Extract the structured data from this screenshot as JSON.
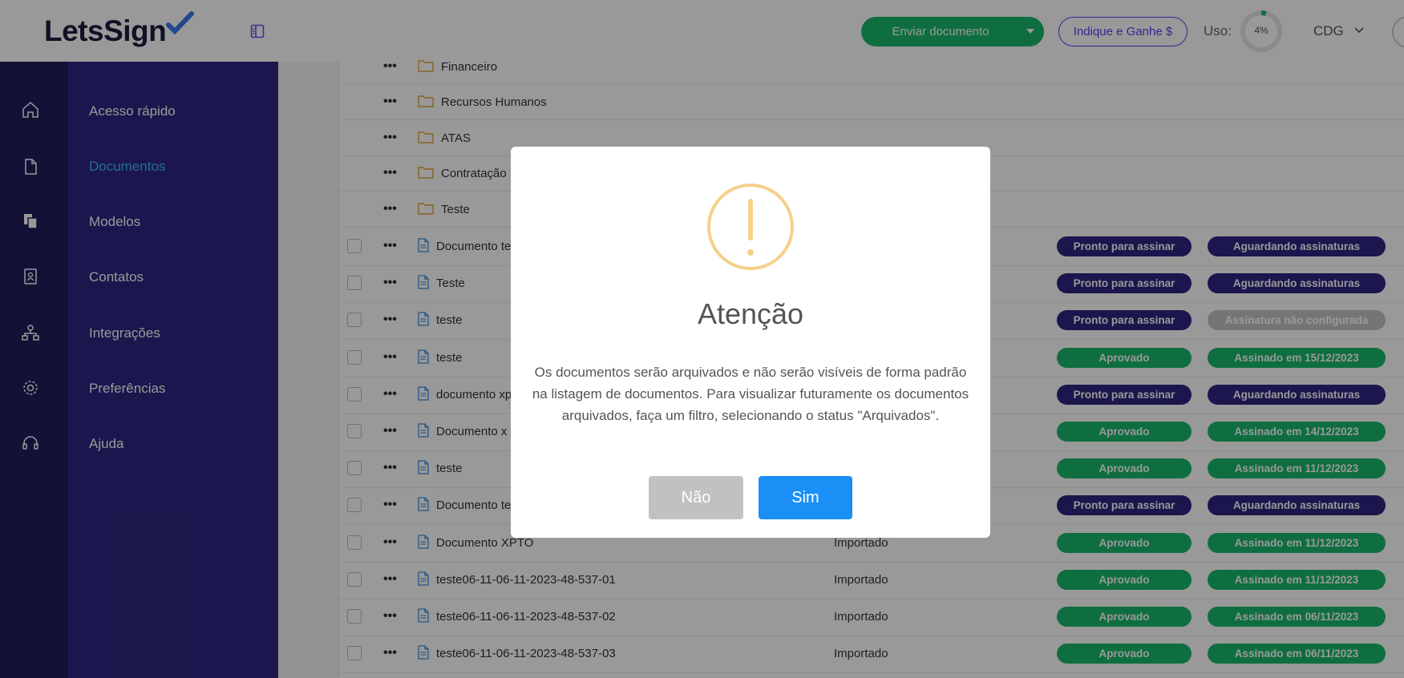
{
  "app": {
    "logo_text": "LetsSign"
  },
  "header": {
    "send_button": "Enviar documento",
    "refer_button": "Indique e Ganhe $",
    "usage_label": "Uso:",
    "usage_value": "4%",
    "usage_percent": 4,
    "account": "CDG"
  },
  "sidebar": {
    "items": [
      {
        "label": "Acesso rápido",
        "icon": "home-icon"
      },
      {
        "label": "Documentos",
        "icon": "document-icon",
        "active": true
      },
      {
        "label": "Modelos",
        "icon": "templates-icon"
      },
      {
        "label": "Contatos",
        "icon": "contacts-icon"
      },
      {
        "label": "Integrações",
        "icon": "integrations-icon"
      },
      {
        "label": "Preferências",
        "icon": "gear-icon"
      },
      {
        "label": "Ajuda",
        "icon": "headset-icon"
      }
    ]
  },
  "folders": [
    {
      "name": "Financeiro"
    },
    {
      "name": "Recursos Humanos"
    },
    {
      "name": "ATAS"
    },
    {
      "name": "Contratação"
    },
    {
      "name": "Teste"
    }
  ],
  "documents": [
    {
      "name": "Documento te",
      "origin": "",
      "status": "Pronto para assinar",
      "signature": "Aguardando assinaturas"
    },
    {
      "name": "Teste",
      "origin": "",
      "status": "Pronto para assinar",
      "signature": "Aguardando assinaturas"
    },
    {
      "name": "teste",
      "origin": "",
      "status": "Pronto para assinar",
      "signature": "Assinatura não configurada"
    },
    {
      "name": "teste",
      "origin": "",
      "status": "Aprovado",
      "signature": "Assinado em 15/12/2023"
    },
    {
      "name": "documento xp",
      "origin": "",
      "status": "Pronto para assinar",
      "signature": "Aguardando assinaturas"
    },
    {
      "name": "Documento x",
      "origin": "",
      "status": "Aprovado",
      "signature": "Assinado em 14/12/2023"
    },
    {
      "name": "teste",
      "origin": "",
      "status": "Aprovado",
      "signature": "Assinado em 11/12/2023"
    },
    {
      "name": "Documento te",
      "origin": "",
      "status": "Pronto para assinar",
      "signature": "Aguardando assinaturas"
    },
    {
      "name": "Documento XPTO",
      "origin": "Importado",
      "status": "Aprovado",
      "signature": "Assinado em 11/12/2023"
    },
    {
      "name": "teste06-11-06-11-2023-48-537-01",
      "origin": "Importado",
      "status": "Aprovado",
      "signature": "Assinado em 11/12/2023"
    },
    {
      "name": "teste06-11-06-11-2023-48-537-02",
      "origin": "Importado",
      "status": "Aprovado",
      "signature": "Assinado em 06/11/2023"
    },
    {
      "name": "teste06-11-06-11-2023-48-537-03",
      "origin": "Importado",
      "status": "Aprovado",
      "signature": "Assinado em 06/11/2023"
    }
  ],
  "colors": {
    "status_ready": "#2d2680",
    "status_approved": "#19b86a",
    "status_unconfigured": "#c4c4c4",
    "brand": "#2d2680",
    "accent": "#1a8ff5"
  },
  "modal": {
    "icon": "warning-icon",
    "title": "Atenção",
    "message": "Os documentos serão arquivados e não serão visíveis de forma padrão na listagem de documentos. Para visualizar futuramente os documentos arquivados, faça um filtro, selecionando o status \"Arquivados\".",
    "no_button": "Não",
    "yes_button": "Sim"
  }
}
